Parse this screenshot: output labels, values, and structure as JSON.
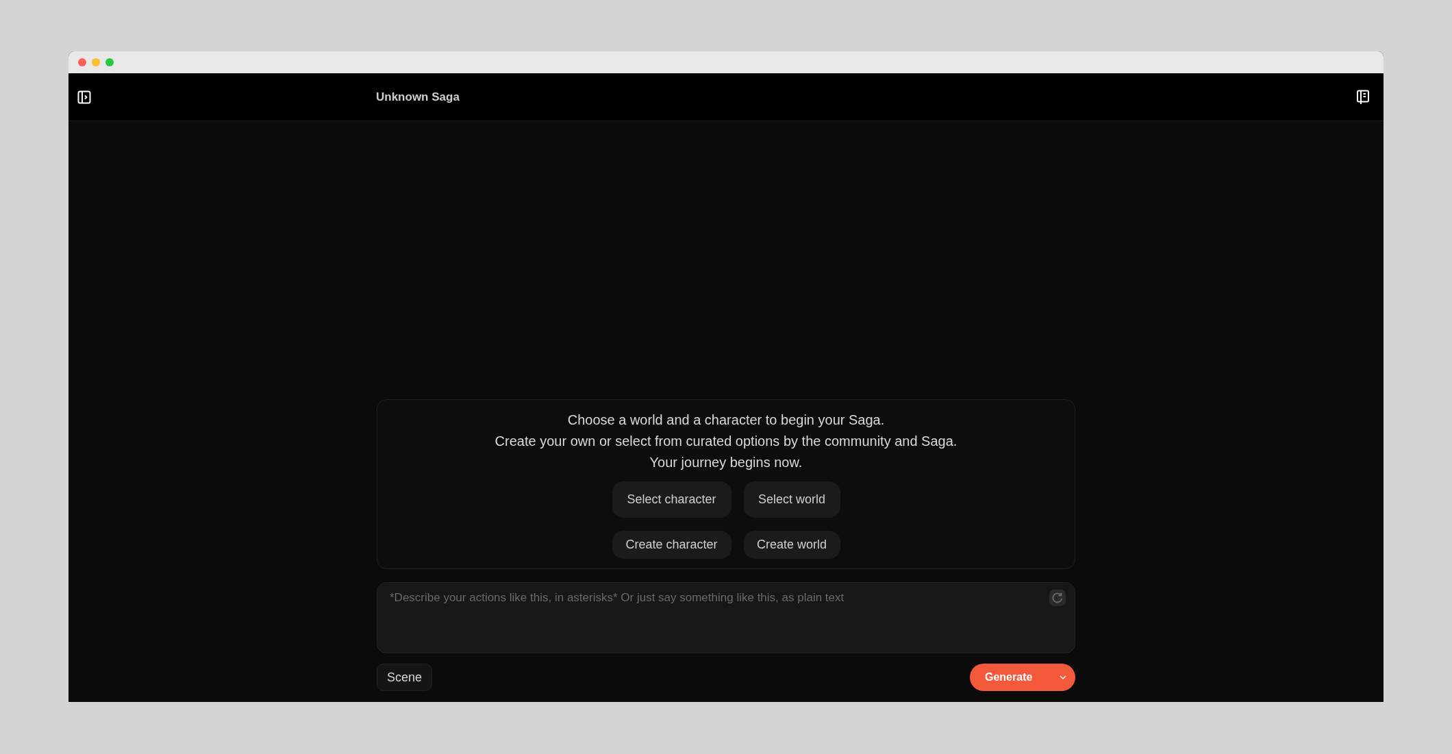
{
  "header": {
    "title": "Unknown Saga"
  },
  "intro": {
    "lines": [
      "Choose a world and a character to begin your Saga.",
      "Create your own or select from curated options by the community and Saga.",
      "Your journey begins now."
    ],
    "action_rows": [
      [
        "Select character",
        "Select world"
      ],
      [
        "Create character",
        "Create world"
      ]
    ]
  },
  "composer": {
    "placeholder": "*Describe your actions like this, in asterisks* Or just say something like this, as plain text"
  },
  "scene_button": "Scene",
  "generate_button": "Generate"
}
